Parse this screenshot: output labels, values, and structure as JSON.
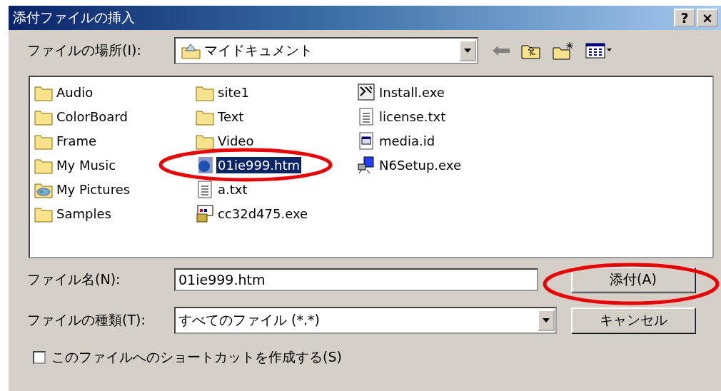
{
  "window": {
    "title": "添付ファイルの挿入",
    "title_buttons": [
      "?",
      "×"
    ]
  },
  "location": {
    "label": "ファイルの場所(I):",
    "value": "マイドキュメント"
  },
  "files": [
    {
      "name": "Audio",
      "kind": "folder",
      "selected": false,
      "circled": false
    },
    {
      "name": "ColorBoard",
      "kind": "folder",
      "selected": false,
      "circled": false
    },
    {
      "name": "Frame",
      "kind": "folder",
      "selected": false,
      "circled": false
    },
    {
      "name": "My Music",
      "kind": "folder",
      "selected": false,
      "circled": false
    },
    {
      "name": "My Pictures",
      "kind": "pictures",
      "selected": false,
      "circled": false
    },
    {
      "name": "Samples",
      "kind": "folder",
      "selected": false,
      "circled": false
    },
    {
      "name": "site1",
      "kind": "folder",
      "selected": false,
      "circled": false
    },
    {
      "name": "Text",
      "kind": "folder",
      "selected": false,
      "circled": false
    },
    {
      "name": "Video",
      "kind": "folder",
      "selected": false,
      "circled": false
    },
    {
      "name": "01ie999.htm",
      "kind": "html",
      "selected": true,
      "circled": true
    },
    {
      "name": "a.txt",
      "kind": "text",
      "selected": false,
      "circled": false
    },
    {
      "name": "cc32d475.exe",
      "kind": "installer",
      "selected": false,
      "circled": false
    },
    {
      "name": "Install.exe",
      "kind": "exe",
      "selected": false,
      "circled": false
    },
    {
      "name": "license.txt",
      "kind": "text",
      "selected": false,
      "circled": false
    },
    {
      "name": "media.id",
      "kind": "app",
      "selected": false,
      "circled": false
    },
    {
      "name": "N6Setup.exe",
      "kind": "setup",
      "selected": false,
      "circled": false
    }
  ],
  "file_name": {
    "label": "ファイル名(N):",
    "value": "01ie999.htm"
  },
  "file_type": {
    "label": "ファイルの種類(T):",
    "value": "すべてのファイル (*.*)"
  },
  "buttons": [
    {
      "label": "添付(A)",
      "circled": true
    },
    {
      "label": "キャンセル",
      "circled": false
    }
  ],
  "shortcut": {
    "label": "このファイルへのショートカットを作成する(S)",
    "checked": false
  }
}
